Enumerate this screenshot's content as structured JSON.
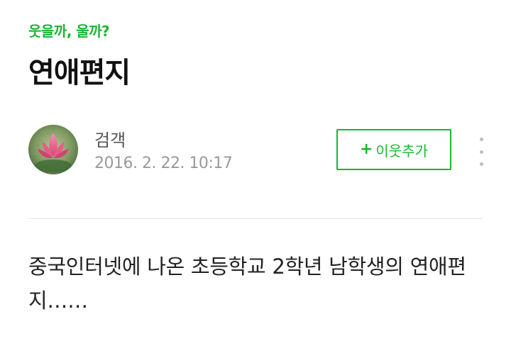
{
  "post": {
    "category": "웃을까, 울까?",
    "title": "연애편지",
    "author": {
      "name": "검객",
      "date": "2016. 2. 22. 10:17",
      "avatar": "lotus-flower-photo"
    },
    "follow_button": {
      "icon": "plus-icon",
      "plus": "+",
      "label": "이웃추가"
    },
    "more_icon": "vertical-ellipsis-icon",
    "body_text": "중국인터넷에 나온 초등학교 2학년 남학생의 연애편지……"
  },
  "colors": {
    "accent": "#1bb631",
    "title": "#111111",
    "meta": "#999999",
    "divider": "#e2e2e2"
  }
}
